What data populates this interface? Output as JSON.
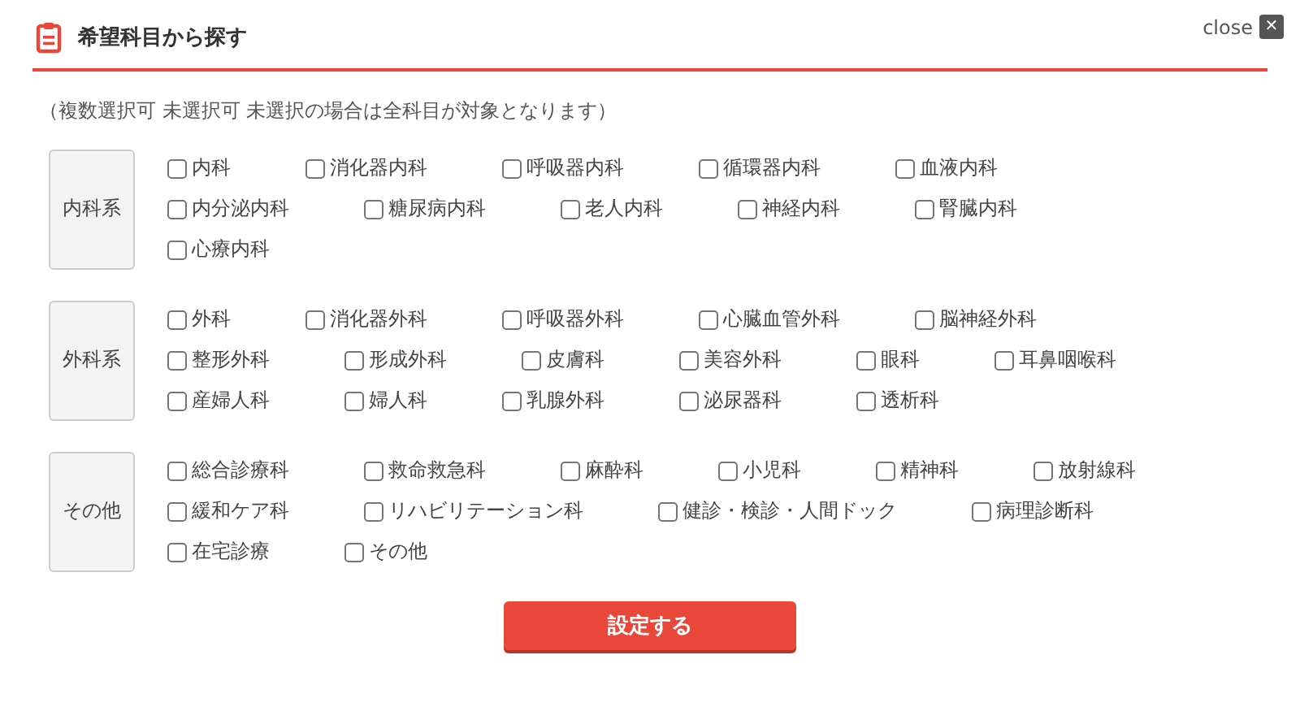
{
  "dialog": {
    "title": "希望科目から探す",
    "close": {
      "label": "close",
      "symbol": "✕"
    }
  },
  "note": "（複数選択可 未選択可 未選択の場合は全科目が対象となります）",
  "groups": [
    {
      "label": "内科系",
      "items": [
        {
          "label": "内科",
          "checked": false
        },
        {
          "label": "消化器内科",
          "checked": false
        },
        {
          "label": "呼吸器内科",
          "checked": false
        },
        {
          "label": "循環器内科",
          "checked": false
        },
        {
          "label": "血液内科",
          "checked": false
        },
        {
          "label": "内分泌内科",
          "checked": false
        },
        {
          "label": "糖尿病内科",
          "checked": false
        },
        {
          "label": "老人内科",
          "checked": false
        },
        {
          "label": "神経内科",
          "checked": false
        },
        {
          "label": "腎臓内科",
          "checked": false
        },
        {
          "label": "心療内科",
          "checked": false
        }
      ]
    },
    {
      "label": "外科系",
      "items": [
        {
          "label": "外科",
          "checked": false
        },
        {
          "label": "消化器外科",
          "checked": false
        },
        {
          "label": "呼吸器外科",
          "checked": false
        },
        {
          "label": "心臓血管外科",
          "checked": false
        },
        {
          "label": "脳神経外科",
          "checked": false
        },
        {
          "label": "整形外科",
          "checked": false
        },
        {
          "label": "形成外科",
          "checked": false
        },
        {
          "label": "皮膚科",
          "checked": false
        },
        {
          "label": "美容外科",
          "checked": false
        },
        {
          "label": "眼科",
          "checked": false
        },
        {
          "label": "耳鼻咽喉科",
          "checked": false
        },
        {
          "label": "産婦人科",
          "checked": false
        },
        {
          "label": "婦人科",
          "checked": false
        },
        {
          "label": "乳腺外科",
          "checked": false
        },
        {
          "label": "泌尿器科",
          "checked": false
        },
        {
          "label": "透析科",
          "checked": false
        }
      ]
    },
    {
      "label": "その他",
      "items": [
        {
          "label": "総合診療科",
          "checked": false
        },
        {
          "label": "救命救急科",
          "checked": false
        },
        {
          "label": "麻酔科",
          "checked": false
        },
        {
          "label": "小児科",
          "checked": false
        },
        {
          "label": "精神科",
          "checked": false
        },
        {
          "label": "放射線科",
          "checked": false
        },
        {
          "label": "緩和ケア科",
          "checked": false
        },
        {
          "label": "リハビリテーション科",
          "checked": false
        },
        {
          "label": "健診・検診・人間ドック",
          "checked": false
        },
        {
          "label": "病理診断科",
          "checked": false
        },
        {
          "label": "在宅診療",
          "checked": false
        },
        {
          "label": "その他",
          "checked": false
        }
      ]
    }
  ],
  "submit": "設定する"
}
